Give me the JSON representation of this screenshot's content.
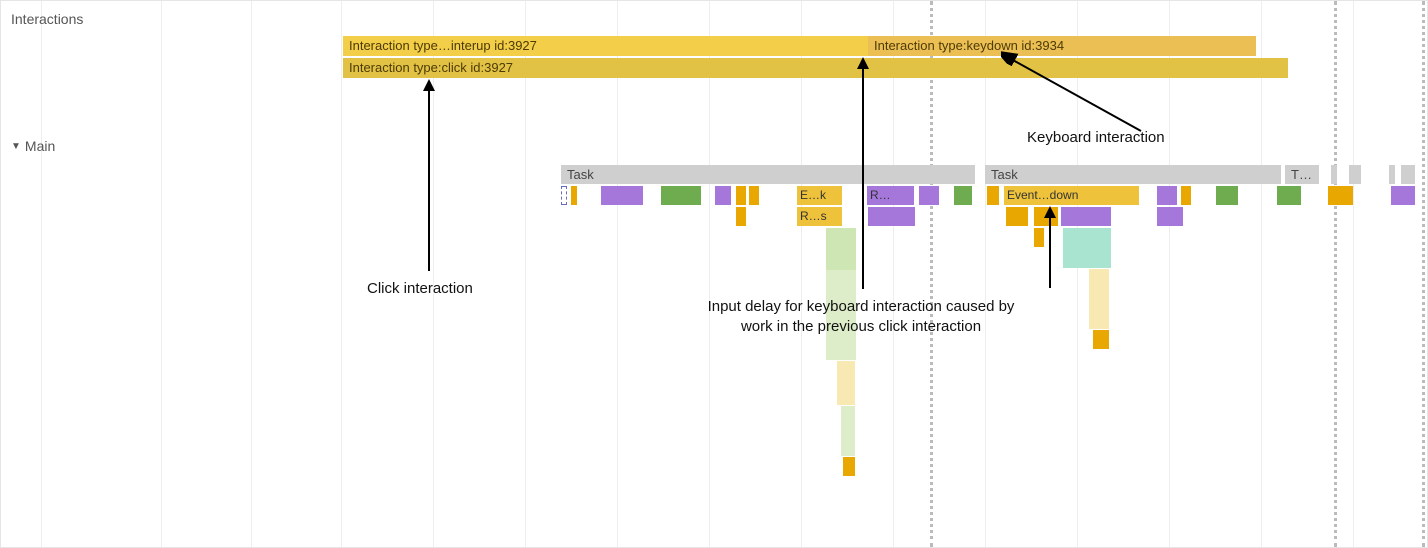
{
  "tracks": {
    "interactions_label": "Interactions",
    "main_label": "Main"
  },
  "interactions": {
    "pointerup": "Interaction type…interup id:3927",
    "click": "Interaction type:click id:3927",
    "keydown": "Interaction type:keydown id:3934"
  },
  "tasks": {
    "task1": "Task",
    "task2": "Task",
    "task3": "T…",
    "eventk": "E…k",
    "rdots": "R…",
    "rs": "R…s",
    "eventdown": "Event…down"
  },
  "annotations": {
    "click_interaction": "Click interaction",
    "keyboard_interaction": "Keyboard interaction",
    "input_delay": "Input delay for keyboard interaction caused by work in the previous click interaction"
  }
}
